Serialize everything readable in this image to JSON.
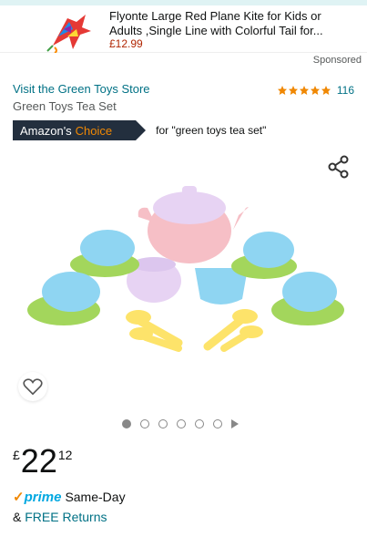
{
  "ad": {
    "title": "Flyonte Large Red Plane Kite for Kids or Adults ,Single Line with Colorful Tail for...",
    "price": "£12.99",
    "thumb_icon": "plane-kite-icon"
  },
  "sponsored_label": "Sponsored",
  "store": {
    "link_text": "Visit the Green Toys Store"
  },
  "rating": {
    "stars": 5,
    "count": "116",
    "star_color": "#f08804"
  },
  "product": {
    "title": "Green Toys Tea Set"
  },
  "badge": {
    "prefix": "Amazon's",
    "choice": "Choice",
    "query": "for \"green toys tea set\""
  },
  "gallery": {
    "image_icon": "tea-set-image",
    "total_dots": 6,
    "active_index": 0,
    "share_icon": "share-icon",
    "wishlist_icon": "heart-icon"
  },
  "price": {
    "currency": "£",
    "whole": "22",
    "fraction": "12"
  },
  "delivery": {
    "prime_check": "✓",
    "prime_word": "prime",
    "prime_text": "Same-Day",
    "returns_prefix": "& ",
    "returns_link": "FREE Returns"
  },
  "colors": {
    "link": "#007185",
    "price_red": "#b12704",
    "badge_bg": "#232f3e",
    "choice_orange": "#f08804",
    "prime_blue": "#00a8e1"
  }
}
